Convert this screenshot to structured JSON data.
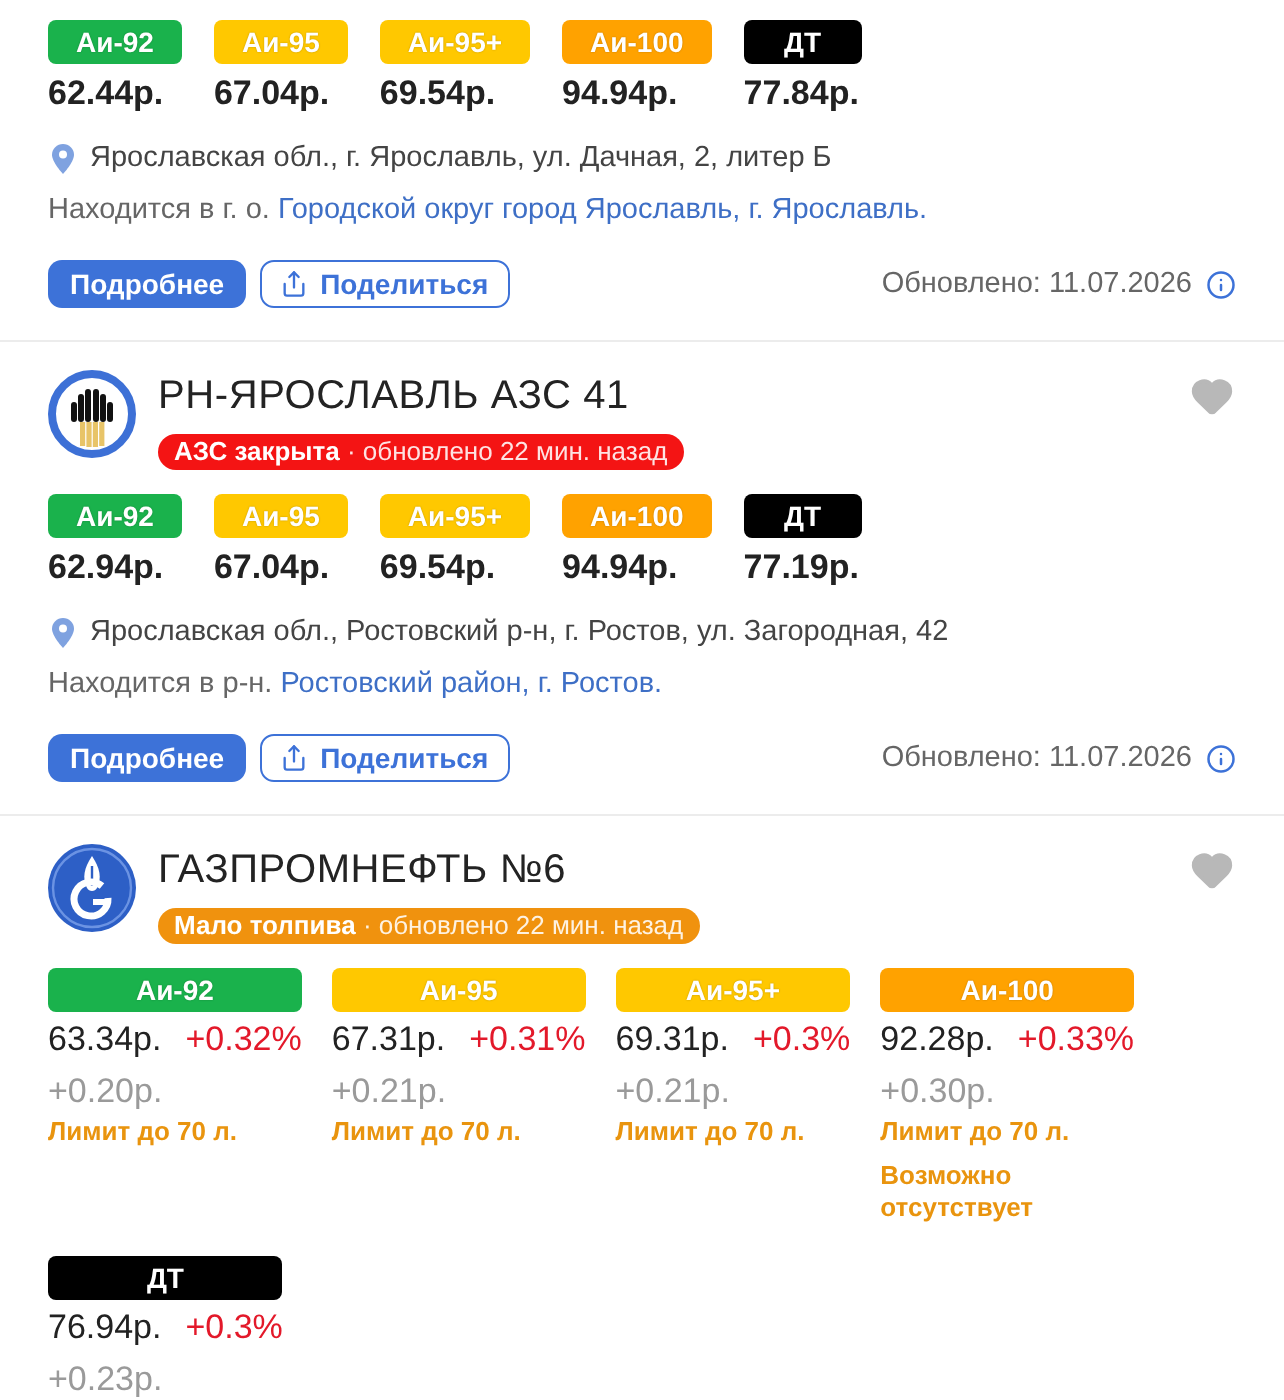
{
  "stations": [
    {
      "kind": "compact",
      "fuels": [
        {
          "label": "Аи-92",
          "color": "#1ab24c",
          "price": "62.44р."
        },
        {
          "label": "Аи-95",
          "color": "#ffc800",
          "price": "67.04р."
        },
        {
          "label": "Аи-95+",
          "color": "#ffc800",
          "price": "69.54р."
        },
        {
          "label": "Аи-100",
          "color": "#ffa200",
          "price": "94.94р."
        },
        {
          "label": "ДТ",
          "color": "#000000",
          "price": "77.84р."
        }
      ],
      "address": "Ярославская обл., г. Ярославль, ул. Дачная, 2, литер Б",
      "area": {
        "prefix": "Находится в г. о.",
        "links": [
          "Городской округ город Ярославль,",
          "г. Ярославль."
        ]
      },
      "actions": {
        "details": "Подробнее",
        "share": "Поделиться"
      },
      "updated": "Обновлено: 11.07.2026"
    },
    {
      "kind": "compact",
      "logo": {
        "kind": "derricks"
      },
      "name": "РН-ЯРОСЛАВЛЬ АЗС 41",
      "favorite": false,
      "status": {
        "kind": "closed",
        "text": "**АЗС закрыта** · обновлено 22 мин. назад"
      },
      "fuels": [
        {
          "label": "Аи-92",
          "color": "#1ab24c",
          "price": "62.94р."
        },
        {
          "label": "Аи-95",
          "color": "#ffc800",
          "price": "67.04р."
        },
        {
          "label": "Аи-95+",
          "color": "#ffc800",
          "price": "69.54р."
        },
        {
          "label": "Аи-100",
          "color": "#ffa200",
          "price": "94.94р."
        },
        {
          "label": "ДТ",
          "color": "#000000",
          "price": "77.19р."
        }
      ],
      "address": "Ярославская обл., Ростовский р-н, г. Ростов, ул. Загородная, 42",
      "area": {
        "prefix": "Находится в р-н.",
        "links": [
          "Ростовский район,",
          "г. Ростов."
        ]
      },
      "actions": {
        "details": "Подробнее",
        "share": "Поделиться"
      },
      "updated": "Обновлено: 11.07.2026"
    },
    {
      "kind": "detailed",
      "logo": {
        "kind": "flame"
      },
      "name": "ГАЗПРОМНЕФТЬ №6",
      "favorite": false,
      "status": {
        "kind": "low_fuel",
        "text": "**Мало толпива** · обновлено 22 мин. назад"
      },
      "fuels": [
        {
          "label": "Аи-92",
          "color": "#1ab24c",
          "price": "63.34р.",
          "change_percent": "+0.32%",
          "change": "+0.20р.",
          "notes": [
            "Лимит до 70 л."
          ]
        },
        {
          "label": "Аи-95",
          "color": "#ffc800",
          "price": "67.31р.",
          "change_percent": "+0.31%",
          "change": "+0.21р.",
          "notes": [
            "Лимит до 70 л."
          ]
        },
        {
          "label": "Аи-95+",
          "color": "#ffc800",
          "price": "69.31р.",
          "change_percent": "+0.3%",
          "change": "+0.21р.",
          "notes": [
            "Лимит до 70 л."
          ]
        },
        {
          "label": "Аи-100",
          "color": "#ffa200",
          "price": "92.28р.",
          "change_percent": "+0.33%",
          "change": "+0.30р.",
          "notes": [
            "Лимит до 70 л.",
            "Возможно отсутствует"
          ]
        },
        {
          "label": "ДТ",
          "color": "#000000",
          "price": "76.94р.",
          "change_percent": "+0.3%",
          "change": "+0.23р."
        }
      ]
    }
  ]
}
